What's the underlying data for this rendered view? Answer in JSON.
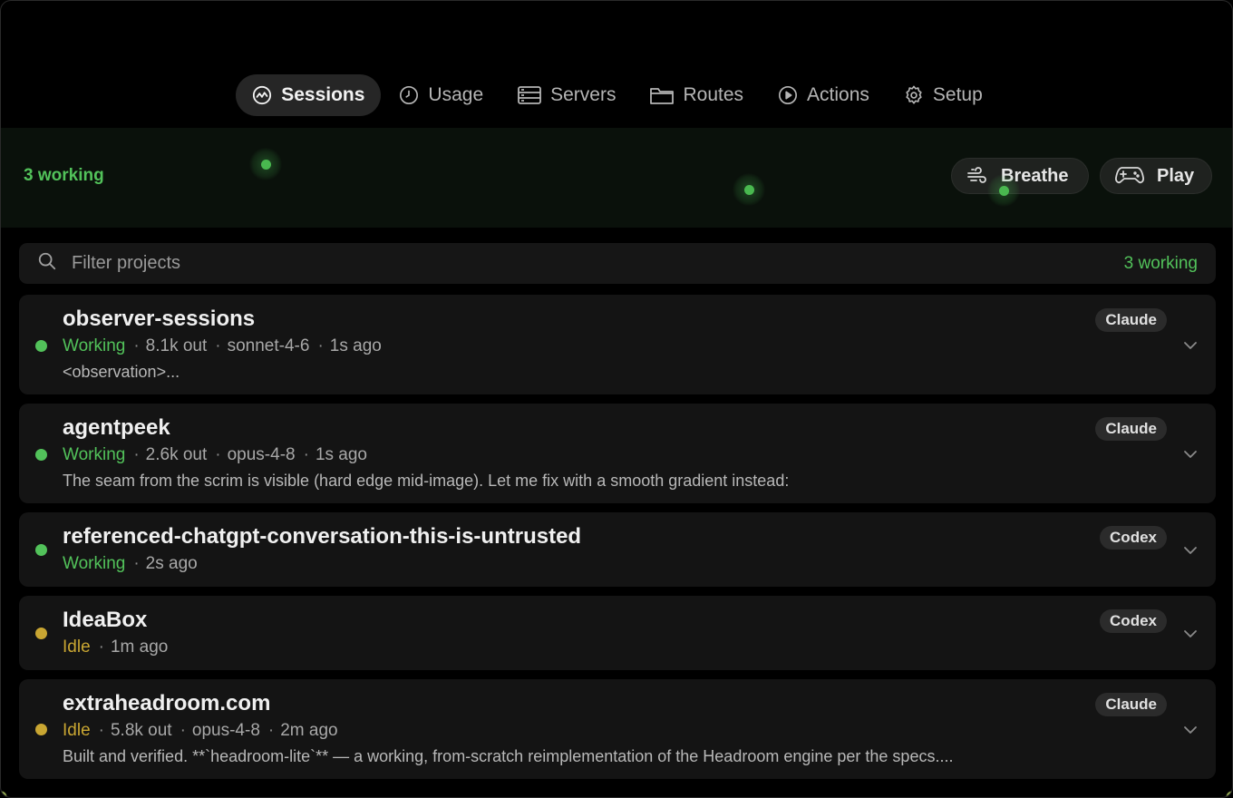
{
  "nav": {
    "tabs": [
      {
        "label": "Sessions",
        "icon": "activity-icon",
        "active": true
      },
      {
        "label": "Usage",
        "icon": "clock-icon",
        "active": false
      },
      {
        "label": "Servers",
        "icon": "server-icon",
        "active": false
      },
      {
        "label": "Routes",
        "icon": "folder-icon",
        "active": false
      },
      {
        "label": "Actions",
        "icon": "play-circle-icon",
        "active": false
      },
      {
        "label": "Setup",
        "icon": "gear-icon",
        "active": false
      }
    ]
  },
  "banner": {
    "working_count": "3 working",
    "breathe_label": "Breathe",
    "play_label": "Play"
  },
  "search": {
    "placeholder": "Filter projects",
    "value": "",
    "count": "3 working"
  },
  "colors": {
    "working": "#52c25a",
    "idle": "#c9a632",
    "background": "#000000",
    "card": "#141414"
  },
  "sessions": [
    {
      "name": "observer-sessions",
      "status": "Working",
      "out": "8.1k out",
      "model": "sonnet-4-6",
      "time": "1s ago",
      "snippet": "<observation>...",
      "agent": "Claude"
    },
    {
      "name": "agentpeek",
      "status": "Working",
      "out": "2.6k out",
      "model": "opus-4-8",
      "time": "1s ago",
      "snippet": "The seam from the scrim is visible (hard edge mid-image). Let me fix with a smooth gradient instead:",
      "agent": "Claude"
    },
    {
      "name": "referenced-chatgpt-conversation-this-is-untrusted",
      "status": "Working",
      "time": "2s ago",
      "agent": "Codex"
    },
    {
      "name": "IdeaBox",
      "status": "Idle",
      "time": "1m ago",
      "agent": "Codex"
    },
    {
      "name": "extraheadroom.com",
      "status": "Idle",
      "out": "5.8k out",
      "model": "opus-4-8",
      "time": "2m ago",
      "snippet": "Built and verified. **`headroom-lite`** — a working, from-scratch reimplementation of the Headroom engine per the specs....",
      "agent": "Claude"
    }
  ]
}
